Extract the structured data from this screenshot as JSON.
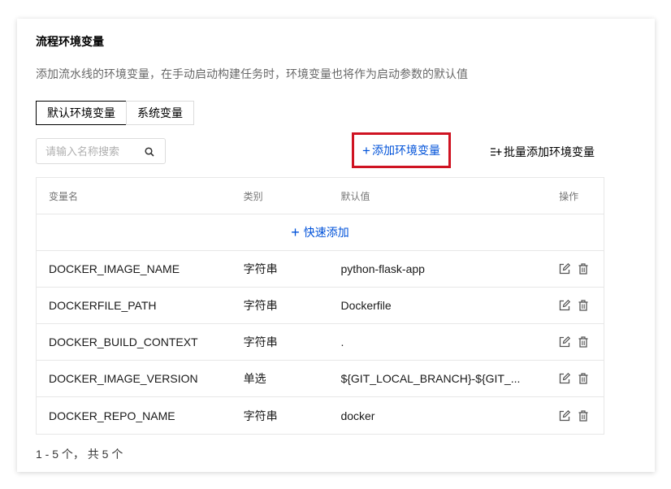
{
  "section": {
    "title": "流程环境变量",
    "description": "添加流水线的环境变量，在手动启动构建任务时，环境变量也将作为启动参数的默认值"
  },
  "tabs": [
    {
      "label": "默认环境变量",
      "active": true
    },
    {
      "label": "系统变量",
      "active": false
    }
  ],
  "search": {
    "placeholder": "请输入名称搜索",
    "value": "",
    "icon": "search-icon"
  },
  "toolbar": {
    "add_label": "添加环境变量",
    "add_icon": "plus-icon",
    "batch_label": "批量添加环境变量",
    "batch_icon": "batch-add-icon",
    "highlight_color": "#cf1322"
  },
  "table": {
    "columns": [
      "变量名",
      "类别",
      "默认值",
      "操作"
    ],
    "quick_add_label": "快速添加",
    "rows": [
      {
        "name": "DOCKER_IMAGE_NAME",
        "type": "字符串",
        "default": "python-flask-app"
      },
      {
        "name": "DOCKERFILE_PATH",
        "type": "字符串",
        "default": "Dockerfile"
      },
      {
        "name": "DOCKER_BUILD_CONTEXT",
        "type": "字符串",
        "default": "."
      },
      {
        "name": "DOCKER_IMAGE_VERSION",
        "type": "单选",
        "default": "${GIT_LOCAL_BRANCH}-${GIT_..."
      },
      {
        "name": "DOCKER_REPO_NAME",
        "type": "字符串",
        "default": "docker"
      }
    ],
    "row_actions": [
      "edit-icon",
      "delete-icon"
    ]
  },
  "pagination": {
    "summary": "1 - 5 个， 共 5 个"
  },
  "colors": {
    "accent": "#0052d9",
    "border": "#e7e7e7"
  }
}
